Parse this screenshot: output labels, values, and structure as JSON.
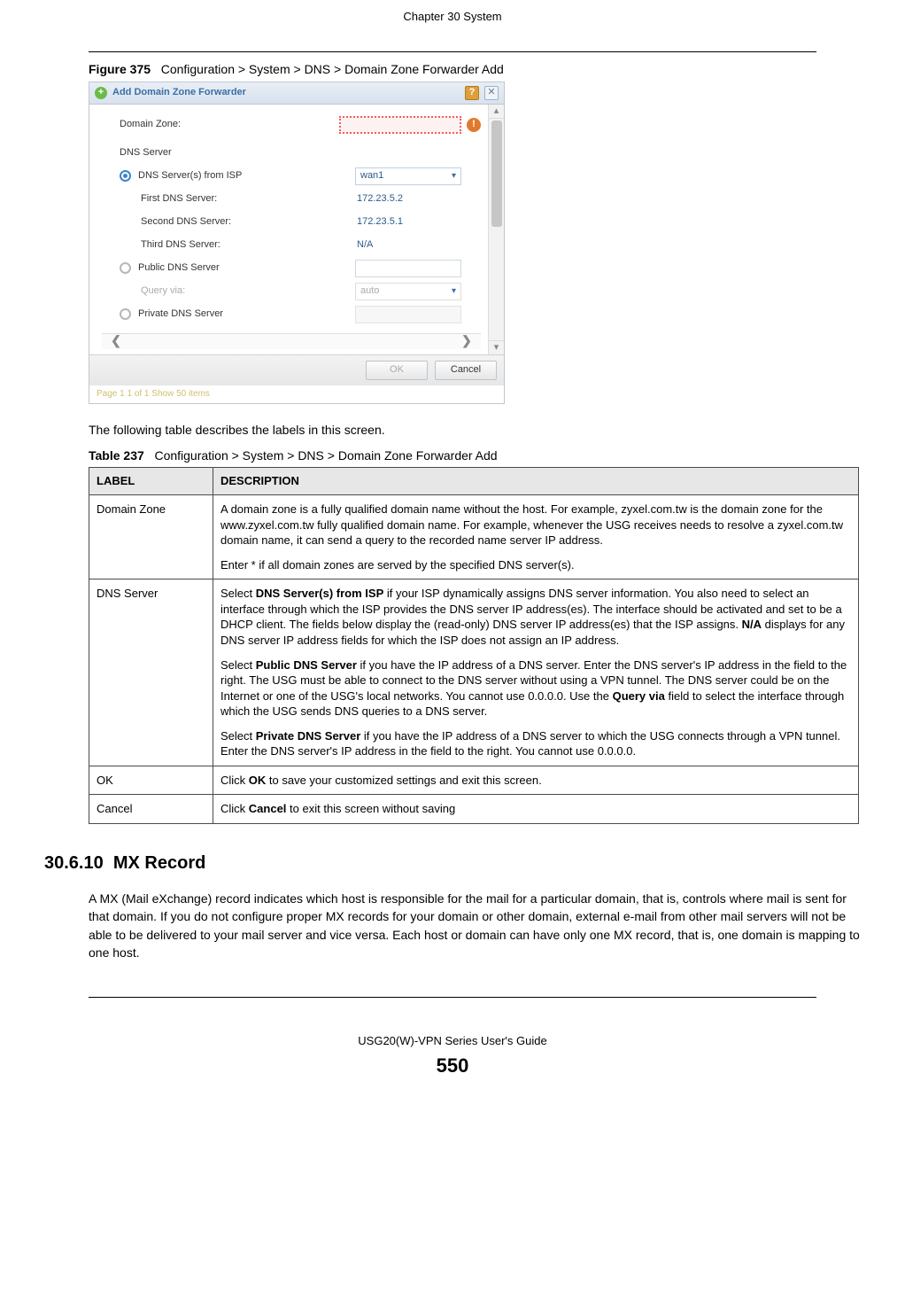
{
  "chapter_header": "Chapter 30 System",
  "figure": {
    "label": "Figure 375",
    "caption": "Configuration > System > DNS > Domain Zone Forwarder Add"
  },
  "dialog": {
    "title": "Add Domain Zone Forwarder",
    "domain_zone_label": "Domain Zone:",
    "dns_server_heading": "DNS Server",
    "radio_isp": "DNS Server(s) from ISP",
    "wan_select": "wan1",
    "first_dns_label": "First DNS Server:",
    "first_dns_value": "172.23.5.2",
    "second_dns_label": "Second DNS Server:",
    "second_dns_value": "172.23.5.1",
    "third_dns_label": "Third DNS Server:",
    "third_dns_value": "N/A",
    "radio_public": "Public DNS Server",
    "query_via_label": "Query via:",
    "query_via_value": "auto",
    "radio_private": "Private DNS Server",
    "ok_label": "OK",
    "cancel_label": "Cancel",
    "status_hint": "Page 1   1 of 1         Show 50     items"
  },
  "intro": "The following table describes the labels in this screen.",
  "table": {
    "label": "Table 237",
    "caption": "Configuration > System > DNS > Domain Zone Forwarder Add",
    "header_label": "LABEL",
    "header_desc": "DESCRIPTION",
    "rows": {
      "r1_label": "Domain Zone",
      "r1_p1": "A domain zone is a fully qualified domain name without the host. For example, zyxel.com.tw is the domain zone for the www.zyxel.com.tw fully qualified domain name. For example, whenever the USG receives needs to resolve a zyxel.com.tw domain name, it can send a query to the recorded name server IP address.",
      "r1_p2": "Enter * if all domain zones are served by the specified DNS server(s).",
      "r2_label": "DNS Server",
      "r2_p1a": "Select ",
      "r2_p1b": "DNS Server(s) from ISP",
      "r2_p1c": " if your ISP dynamically assigns DNS server information. You also need to select an interface through which the ISP provides the DNS server IP address(es). The interface should be activated and set to be a DHCP client. The fields below display the (read-only) DNS server IP address(es) that the ISP assigns. ",
      "r2_p1d": "N/A",
      "r2_p1e": " displays for any DNS server IP address fields for which the ISP does not assign an IP address.",
      "r2_p2a": "Select ",
      "r2_p2b": "Public DNS Server",
      "r2_p2c": " if you have the IP address of a DNS server. Enter the DNS server's IP address in the field to the right. The USG must be able to connect to the DNS server without using a VPN tunnel. The DNS server could be on the Internet or one of the USG's local networks. You cannot use 0.0.0.0. Use the ",
      "r2_p2d": "Query via",
      "r2_p2e": " field to select the interface through which the USG sends DNS queries to a DNS server.",
      "r2_p3a": "Select ",
      "r2_p3b": "Private DNS Server",
      "r2_p3c": " if you have the IP address of a DNS server to which the USG connects through a VPN tunnel. Enter the DNS server's IP address in the field to the right. You cannot use 0.0.0.0.",
      "r3_label": "OK",
      "r3_p1a": "Click ",
      "r3_p1b": "OK",
      "r3_p1c": " to save your customized settings and exit this screen.",
      "r4_label": "Cancel",
      "r4_p1a": "Click ",
      "r4_p1b": "Cancel",
      "r4_p1c": " to exit this screen without saving"
    }
  },
  "section": {
    "number": "30.6.10",
    "title": "MX Record",
    "body": "A MX (Mail eXchange) record indicates which host is responsible for the mail for a particular domain, that is, controls where mail is sent for that domain. If you do not configure proper MX records for your domain or other domain, external e-mail from other mail servers will not be able to be delivered to your mail server and vice versa. Each host or domain can have only one MX record, that is, one domain is mapping to one host."
  },
  "footer": {
    "guide": "USG20(W)-VPN Series User's Guide",
    "page": "550"
  }
}
